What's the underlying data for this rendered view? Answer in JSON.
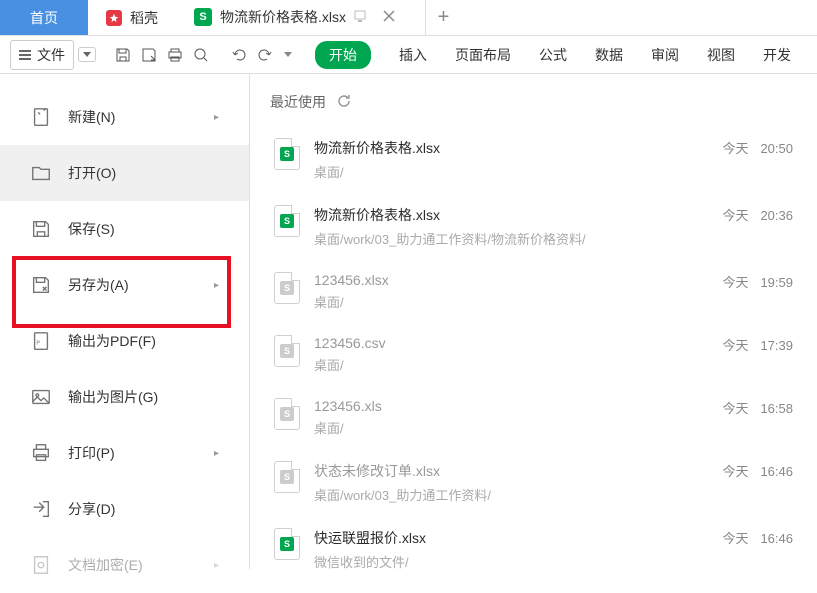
{
  "tabs": {
    "home": "首页",
    "docer": "稻壳",
    "file": "物流新价格表格.xlsx"
  },
  "toolbar": {
    "file_label": "文件"
  },
  "ribbon": {
    "start": "开始",
    "insert": "插入",
    "layout": "页面布局",
    "formula": "公式",
    "data": "数据",
    "review": "审阅",
    "view": "视图",
    "dev": "开发"
  },
  "file_menu": {
    "new": "新建(N)",
    "open": "打开(O)",
    "save": "保存(S)",
    "save_as": "另存为(A)",
    "pdf": "输出为PDF(F)",
    "image": "输出为图片(G)",
    "print": "打印(P)",
    "share": "分享(D)",
    "encrypt": "文档加密(E)"
  },
  "recent": {
    "title": "最近使用",
    "items": [
      {
        "name": "物流新价格表格.xlsx",
        "path": "桌面/",
        "day": "今天",
        "time": "20:50",
        "color": "green"
      },
      {
        "name": "物流新价格表格.xlsx",
        "path": "桌面/work/03_助力通工作资料/物流新价格资料/",
        "day": "今天",
        "time": "20:36",
        "color": "green"
      },
      {
        "name": "123456.xlsx",
        "path": "桌面/",
        "day": "今天",
        "time": "19:59",
        "color": "gray"
      },
      {
        "name": "123456.csv",
        "path": "桌面/",
        "day": "今天",
        "time": "17:39",
        "color": "gray"
      },
      {
        "name": "123456.xls",
        "path": "桌面/",
        "day": "今天",
        "time": "16:58",
        "color": "gray"
      },
      {
        "name": "状态未修改订单.xlsx",
        "path": "桌面/work/03_助力通工作资料/",
        "day": "今天",
        "time": "16:46",
        "color": "gray"
      },
      {
        "name": "快运联盟报价.xlsx",
        "path": "微信收到的文件/",
        "day": "今天",
        "time": "16:46",
        "color": "green"
      }
    ]
  }
}
